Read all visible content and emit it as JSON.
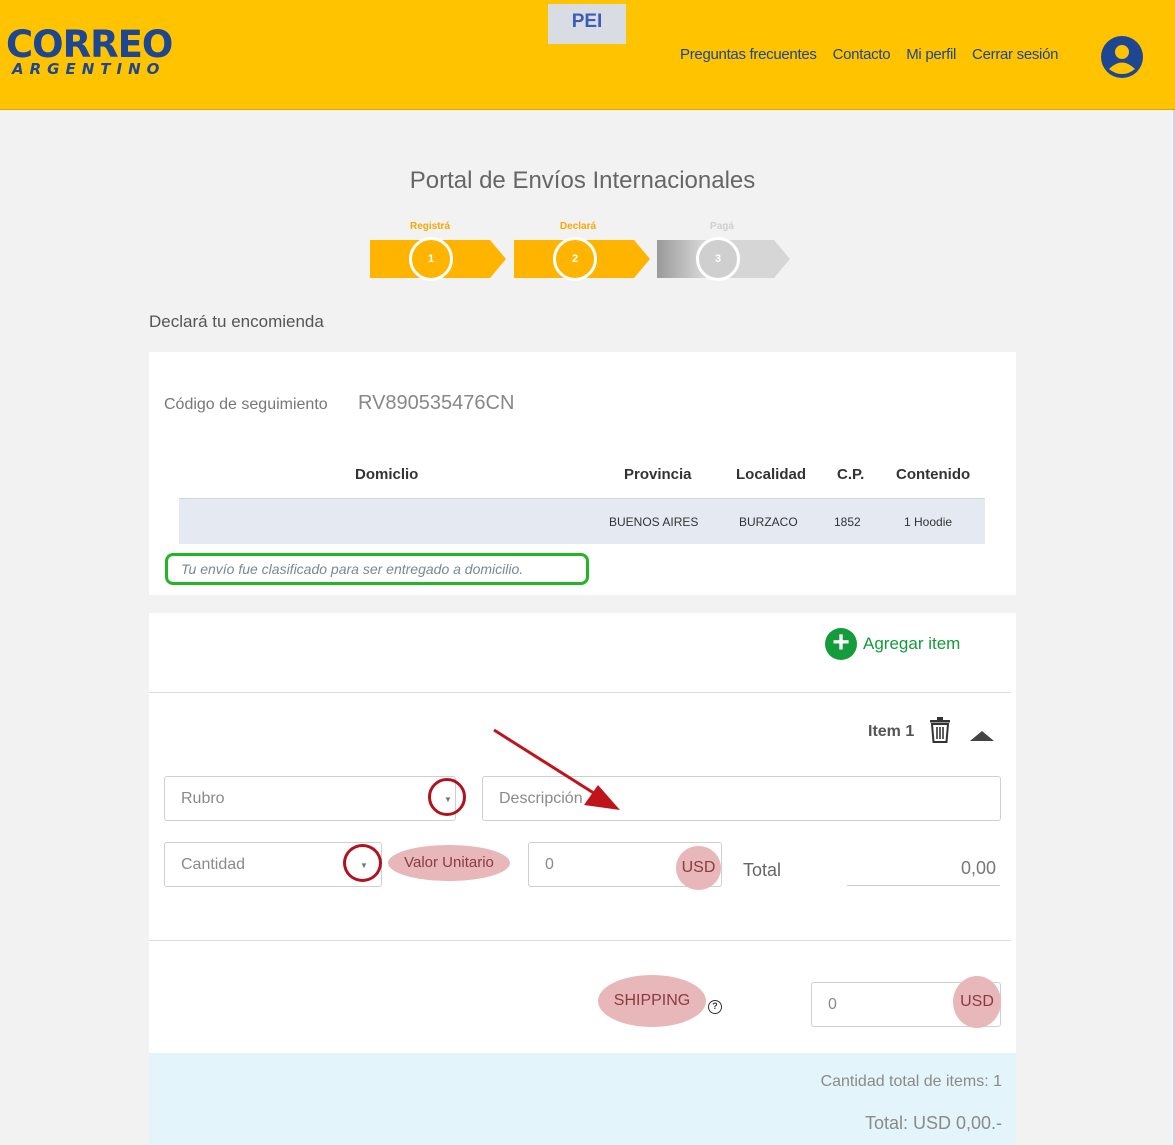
{
  "header": {
    "logo_main": "CORREO",
    "logo_sub": "ARGENTINO",
    "badge": "PEI",
    "nav": [
      "Preguntas frecuentes",
      "Contacto",
      "Mi perfil",
      "Cerrar sesión"
    ],
    "brand_color": "#ffc300",
    "text_color": "#1d4693"
  },
  "page": {
    "title": "Portal de Envíos Internacionales",
    "subtitle": "Declará tu encomienda"
  },
  "steps": [
    {
      "label": "Registrá",
      "number": "1",
      "state": "done"
    },
    {
      "label": "Declará",
      "number": "2",
      "state": "active"
    },
    {
      "label": "Pagá",
      "number": "3",
      "state": "pending"
    }
  ],
  "shipment": {
    "tracking_label": "Código de seguimiento",
    "tracking_code": "RV890535476CN",
    "columns": [
      "Domiclio",
      "Provincia",
      "Localidad",
      "C.P.",
      "Contenido"
    ],
    "row": [
      "",
      "BUENOS AIRES",
      "BURZACO",
      "1852",
      "1 Hoodie"
    ],
    "notice": "Tu envío fue clasificado para ser entregado a domicilio."
  },
  "items": {
    "add_label": "Agregar item",
    "item_label": "Item 1",
    "rubro_placeholder": "Rubro",
    "descripcion_placeholder": "Descripción",
    "cantidad_placeholder": "Cantidad",
    "valor_unitario_label": "Valor Unitario",
    "valor_value": "0",
    "currency": "USD",
    "total_label": "Total",
    "total_value": "0,00",
    "shipping_label": "SHIPPING",
    "shipping_value": "0",
    "help_icon": "question-circle-icon"
  },
  "summary": {
    "count_text": "Cantidad total de items: 1",
    "total_text": "Total: USD 0,00.-"
  }
}
